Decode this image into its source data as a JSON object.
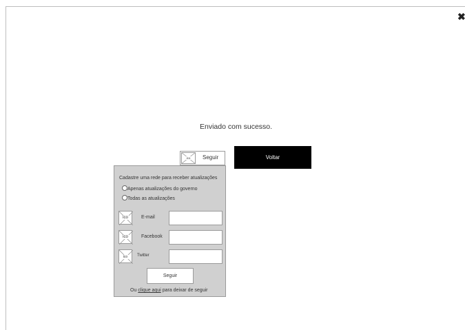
{
  "dialog": {
    "close_icon": "close-icon",
    "success_message": "Enviado com sucesso.",
    "back_label": "Voltar"
  },
  "follow_toggle": {
    "icon_label": "ico",
    "label": "Seguir"
  },
  "follow_panel": {
    "title": "Cadastre uma rede para receber atualizações",
    "options": [
      {
        "label": "Apenas atualizações do governo",
        "selected": false
      },
      {
        "label": "Todas as atualizações",
        "selected": false
      }
    ],
    "networks": [
      {
        "icon_label": "ico",
        "label": "E-mail",
        "value": ""
      },
      {
        "icon_label": "ico",
        "label": "Facebook",
        "value": ""
      },
      {
        "icon_label": "ico",
        "label": "Twitter",
        "value": ""
      }
    ],
    "follow_label": "Seguir",
    "unfollow_prefix": "Ou",
    "unfollow_link": "clique aqui",
    "unfollow_suffix": "para deixar de seguir"
  }
}
